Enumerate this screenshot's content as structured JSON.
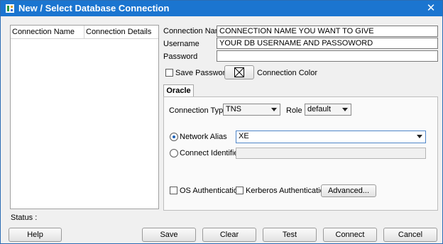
{
  "window": {
    "title": "New / Select Database Connection",
    "close_glyph": "✕"
  },
  "list": {
    "col_name": "Connection Name",
    "col_details": "Connection Details"
  },
  "form": {
    "connection_name_label": "Connection Name",
    "connection_name_value": "CONNECTION NAME YOU WANT TO GIVE",
    "username_label": "Username",
    "username_value": "YOUR DB USERNAME AND PASSOWORD",
    "password_label": "Password",
    "password_value": "",
    "save_password_label": "Save Password",
    "save_password_checked": false,
    "connection_color_label": "Connection Color"
  },
  "tab": {
    "label": "Oracle"
  },
  "oracle": {
    "connection_type_label": "Connection Type",
    "connection_type_value": "TNS",
    "role_label": "Role",
    "role_value": "default",
    "network_alias_label": "Network Alias",
    "network_alias_value": "XE",
    "network_alias_selected": true,
    "connect_identifier_label": "Connect Identifier",
    "connect_identifier_value": "",
    "os_auth_label": "OS Authentication",
    "kerberos_auth_label": "Kerberos Authentication",
    "advanced_label": "Advanced..."
  },
  "status": {
    "label": "Status :"
  },
  "buttons": {
    "help": "Help",
    "save": "Save",
    "clear": "Clear",
    "test": "Test",
    "connect": "Connect",
    "cancel": "Cancel"
  },
  "colors": {
    "titlebar": "#1b75d0",
    "radio_dot": "#1f62b8"
  },
  "icons": {
    "app": "database-connection-icon",
    "color_swatch": "empty-color-swatch-icon"
  }
}
